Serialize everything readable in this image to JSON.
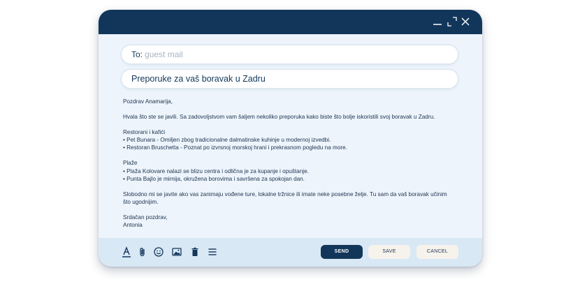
{
  "window": {
    "controls": {
      "minimize_icon": "minimize-icon",
      "maximize_icon": "maximize-icon",
      "close_icon": "close-icon"
    }
  },
  "compose": {
    "to_label": "To:",
    "to_placeholder": "guest mail",
    "subject": "Preporuke za vaš boravak u Zadru"
  },
  "message": {
    "greeting": "Pozdrav Anamarija,",
    "intro": "Hvala što ste se javili. Sa zadovoljstvom vam šaljem nekoliko preporuka kako biste što bolje iskoristili svoj boravak u Zadru.",
    "section1_title": "Restorani i kafići",
    "section1_items": [
      "• Pet Bunara - Omiljen zbog tradicionalne dalmatinske kuhinje u modernoj izvedbi.",
      "• Restoran Bruschetta - Poznat po izvrsnoj morskoj hrani i prekrasnom pogledu na more."
    ],
    "section2_title": "Plaže",
    "section2_items": [
      "• Plaža Kolovare nalazi se blizu centra i odlična je za kupanje i opuštanje.",
      "• Punta Bajlo je mirnija, okružena borovima i savršena za spokojan dan."
    ],
    "closing_line1": "Slobodno mi se javite ako vas zanimaju vođene ture, lokalne tržnice ili imate neke posebne želje. Tu sam da vaš boravak učinim",
    "closing_line2": "što ugodnijim.",
    "signoff": "Srdačan pozdrav,",
    "signature": "Antonia"
  },
  "toolbar": {
    "icons": [
      "text-format-icon",
      "attachment-icon",
      "emoji-icon",
      "image-icon",
      "delete-icon",
      "menu-icon"
    ],
    "send_label": "SEND",
    "save_label": "SAVE",
    "cancel_label": "CANCEL"
  },
  "colors": {
    "titlebar": "#12365a",
    "window_bg": "#eef4fb",
    "toolbar_bg": "#d9e8f5",
    "accent": "#12365a"
  }
}
